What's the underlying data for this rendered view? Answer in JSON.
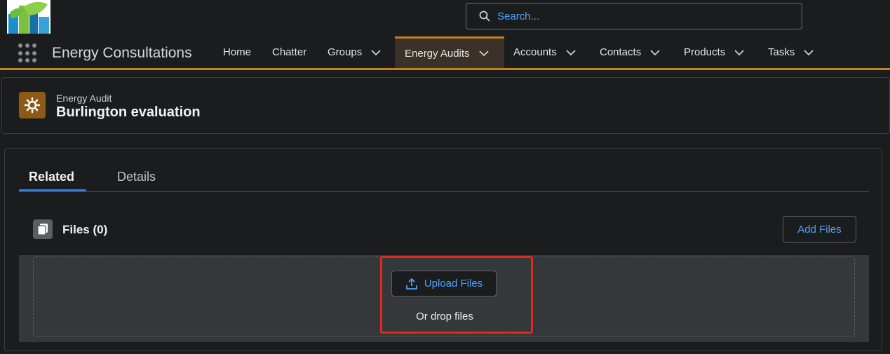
{
  "search": {
    "placeholder": "Search..."
  },
  "app": {
    "name": "Energy Consultations"
  },
  "nav": {
    "items": [
      {
        "label": "Home",
        "has_menu": false
      },
      {
        "label": "Chatter",
        "has_menu": false
      },
      {
        "label": "Groups",
        "has_menu": true
      },
      {
        "label": "Energy Audits",
        "has_menu": true,
        "active": true
      },
      {
        "label": "Accounts",
        "has_menu": true
      },
      {
        "label": "Contacts",
        "has_menu": true
      },
      {
        "label": "Products",
        "has_menu": true
      },
      {
        "label": "Tasks",
        "has_menu": true
      }
    ]
  },
  "record": {
    "object_type": "Energy Audit",
    "title": "Burlington evaluation",
    "icon": "gear-icon"
  },
  "tabs": [
    {
      "label": "Related",
      "active": true
    },
    {
      "label": "Details",
      "active": false
    }
  ],
  "files": {
    "title": "Files (0)",
    "add_button": "Add Files",
    "upload_button": "Upload Files",
    "drop_text": "Or drop files"
  },
  "colors": {
    "accent": "#c77f1c",
    "link": "#4fa3f7",
    "highlight": "#e0281e",
    "tab_underline": "#2f7de1"
  }
}
